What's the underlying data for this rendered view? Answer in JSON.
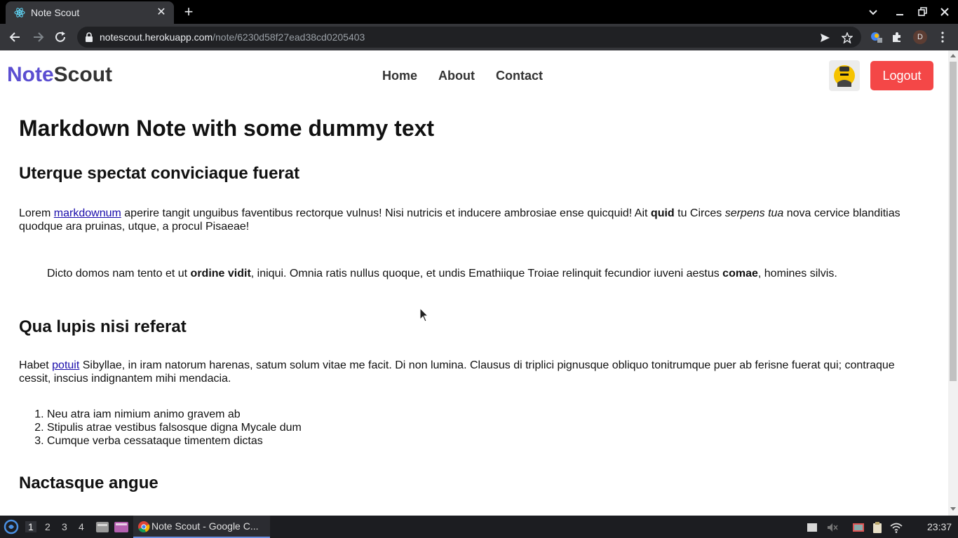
{
  "browser": {
    "tab_title": "Note Scout",
    "url_host": "notescout.herokuapp.com",
    "url_path": "/note/6230d58f27ead38cd0205403",
    "profile_initial": "D"
  },
  "site": {
    "brand_part1": "Note",
    "brand_part2": "Scout",
    "nav": [
      "Home",
      "About",
      "Contact"
    ],
    "logout_label": "Logout",
    "accent_color": "#5b4ed1",
    "logout_color": "#f44747"
  },
  "note": {
    "title": "Markdown Note with some dummy text",
    "section1_heading": "Uterque spectat conviciaque fuerat",
    "p1_start": "Lorem ",
    "p1_link": "markdownum",
    "p1_mid1": " aperire tangit unguibus faventibus rectorque vulnus! Nisi nutricis et inducere ambrosiae ense quicquid! Ait ",
    "p1_bold": "quid",
    "p1_mid2": " tu Circes ",
    "p1_italic": "serpens tua",
    "p1_end": " nova cervice blanditias quodque ara pruinas, utque, a procul Pisaeae!",
    "quote_start": "Dicto domos nam tento et ut ",
    "quote_bold1": "ordine vidit",
    "quote_mid": ", iniqui. Omnia ratis nullus quoque, et undis Emathiique Troiae relinquit fecundior iuveni aestus ",
    "quote_bold2": "comae",
    "quote_end": ", homines silvis.",
    "section2_heading": "Qua lupis nisi referat",
    "p2_start": "Habet ",
    "p2_link": "potuit",
    "p2_end": " Sibyllae, in iram natorum harenas, satum solum vitae me facit. Di non lumina. Clausus di triplici pignusque obliquo tonitrumque puer ab ferisne fuerat qui; contraque cessit, inscius indignantem mihi mendacia.",
    "list": [
      "Neu atra iam nimium animo gravem ab",
      "Stipulis atrae vestibus falsosque digna Mycale dum",
      "Cumque verba cessataque timentem dictas"
    ],
    "section3_heading": "Nactasque angue"
  },
  "taskbar": {
    "workspaces": [
      "1",
      "2",
      "3",
      "4"
    ],
    "active_task": "Note Scout - Google C...",
    "clock": "23:37"
  }
}
